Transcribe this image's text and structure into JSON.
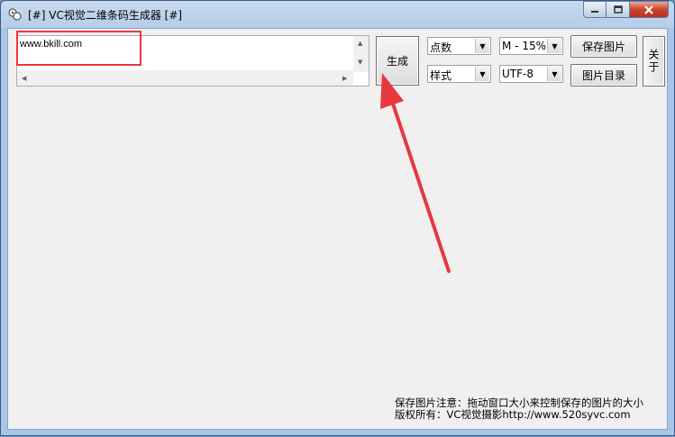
{
  "window": {
    "title": "[#] VC视觉二维条码生成器 [#]"
  },
  "input": {
    "value": "www.bkill.com"
  },
  "buttons": {
    "generate": "生成",
    "save_image": "保存图片",
    "image_dir": "图片目录",
    "about": "关于"
  },
  "selects": {
    "mode": "点数",
    "style": "样式",
    "error_level": "M - 15%",
    "encoding": "UTF-8"
  },
  "footer": {
    "line1": "保存图片注意：拖动窗口大小来控制保存的图片的大小",
    "line2": "版权所有：VC视觉摄影http://www.520syvc.com"
  },
  "colors": {
    "annotation": "#e8383d"
  },
  "icons": [
    "app-icon",
    "minimize-icon",
    "maximize-icon",
    "close-icon",
    "scroll-up-icon",
    "scroll-down-icon",
    "scroll-left-icon",
    "scroll-right-icon",
    "dropdown-arrow-icon"
  ]
}
